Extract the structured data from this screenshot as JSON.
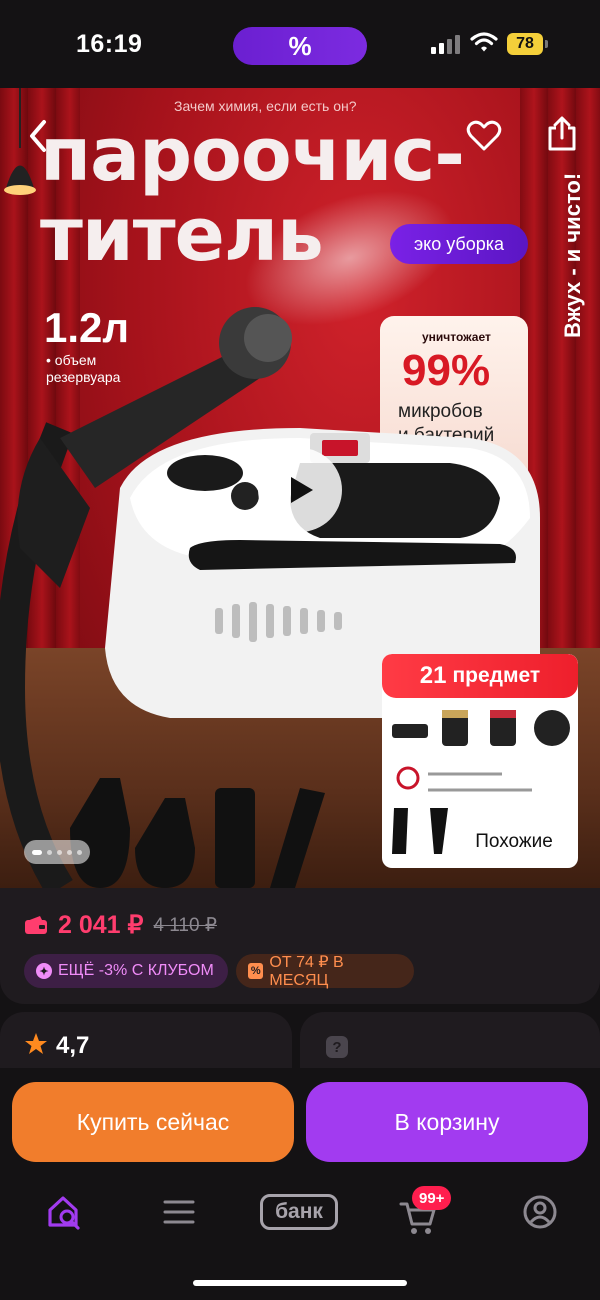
{
  "status_bar": {
    "time": "16:19",
    "promo_symbol": "%",
    "battery": "78"
  },
  "hero": {
    "subtitle": "Зачем химия, если есть  он?",
    "headline_line1": "пароочис-",
    "headline_line2": "титель",
    "eco_badge": "эко уборка",
    "vertical_slogan": "Вжух - и чисто!",
    "volume_value": "1.2л",
    "volume_caption_line1": "• объем",
    "volume_caption_line2": "резервуара",
    "kill_card": {
      "label": "уничтожает",
      "percent": "99%",
      "text_line1": "микробов",
      "text_line2": "и бактерий"
    },
    "kit_card": {
      "count": "21",
      "label": "предмет"
    },
    "similar_label": "Похожие",
    "gallery_dots": 5,
    "gallery_active_index": 0
  },
  "price": {
    "current": "2 041 ₽",
    "old": "4 110 ₽",
    "club_chip": "ЕЩЁ -3% С КЛУБОМ",
    "month_chip": "ОТ 74 ₽ В МЕСЯЦ"
  },
  "rating": {
    "value": "4,7"
  },
  "qa": {
    "icon": "question-icon"
  },
  "actions": {
    "buy_now": "Купить сейчас",
    "add_to_cart": "В корзину"
  },
  "tab_bar": {
    "bank_label": "банк",
    "cart_badge": "99+"
  },
  "colors": {
    "accent_purple": "#a23bf0",
    "accent_orange": "#f17d2c",
    "price_pink": "#ff3d6e"
  }
}
